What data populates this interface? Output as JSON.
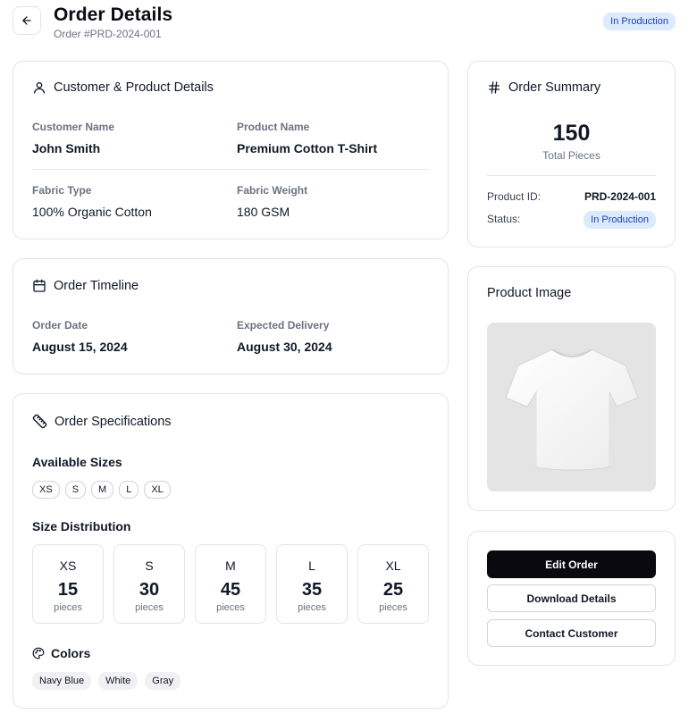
{
  "header": {
    "title": "Order Details",
    "subtitle": "Order #PRD-2024-001",
    "status_badge": "In Production"
  },
  "customer_card": {
    "title": "Customer & Product Details",
    "customer_name_label": "Customer Name",
    "customer_name": "John Smith",
    "product_name_label": "Product Name",
    "product_name": "Premium Cotton T-Shirt",
    "fabric_type_label": "Fabric Type",
    "fabric_type": "100% Organic Cotton",
    "fabric_weight_label": "Fabric Weight",
    "fabric_weight": "180 GSM"
  },
  "timeline_card": {
    "title": "Order Timeline",
    "order_date_label": "Order Date",
    "order_date": "August 15, 2024",
    "delivery_label": "Expected Delivery",
    "delivery_date": "August 30, 2024"
  },
  "specs_card": {
    "title": "Order Specifications",
    "sizes_heading": "Available Sizes",
    "sizes": [
      "XS",
      "S",
      "M",
      "L",
      "XL"
    ],
    "distribution_heading": "Size Distribution",
    "distribution": [
      {
        "size": "XS",
        "count": "15",
        "unit": "pieces"
      },
      {
        "size": "S",
        "count": "30",
        "unit": "pieces"
      },
      {
        "size": "M",
        "count": "45",
        "unit": "pieces"
      },
      {
        "size": "L",
        "count": "35",
        "unit": "pieces"
      },
      {
        "size": "XL",
        "count": "25",
        "unit": "pieces"
      }
    ],
    "colors_heading": "Colors",
    "colors": [
      "Navy Blue",
      "White",
      "Gray"
    ]
  },
  "summary_card": {
    "title": "Order Summary",
    "total": "150",
    "total_label": "Total Pieces",
    "product_id_label": "Product ID:",
    "product_id": "PRD-2024-001",
    "status_label": "Status:",
    "status": "In Production"
  },
  "image_card": {
    "title": "Product Image"
  },
  "actions": {
    "edit": "Edit Order",
    "download": "Download Details",
    "contact": "Contact Customer"
  },
  "theme": {
    "badge_bg": "#dbeafe",
    "badge_text": "#1e40af",
    "primary_button": "#09090f"
  },
  "icons": [
    "arrow-left-icon",
    "user-icon",
    "calendar-icon",
    "ruler-icon",
    "palette-icon",
    "hash-icon",
    "tshirt-image"
  ]
}
